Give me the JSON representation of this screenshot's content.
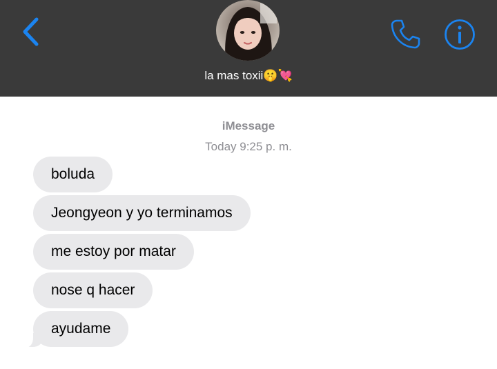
{
  "header": {
    "back_icon": "chevron-left-icon",
    "contact_name": "la mas toxii",
    "contact_emoji": "🤫💘",
    "phone_icon": "phone-icon",
    "info_icon": "info-icon",
    "accent_color": "#1b84f0",
    "background_color": "#3a3a3a"
  },
  "thread": {
    "service": "iMessage",
    "timestamp": "Today 9:25 p. m.",
    "messages": [
      {
        "text": "boluda",
        "direction": "incoming"
      },
      {
        "text": "Jeongyeon y yo terminamos",
        "direction": "incoming"
      },
      {
        "text": "me estoy por matar",
        "direction": "incoming"
      },
      {
        "text": "nose q hacer",
        "direction": "incoming"
      },
      {
        "text": "ayudame",
        "direction": "incoming"
      }
    ],
    "bubble_color": "#e9e9eb"
  }
}
